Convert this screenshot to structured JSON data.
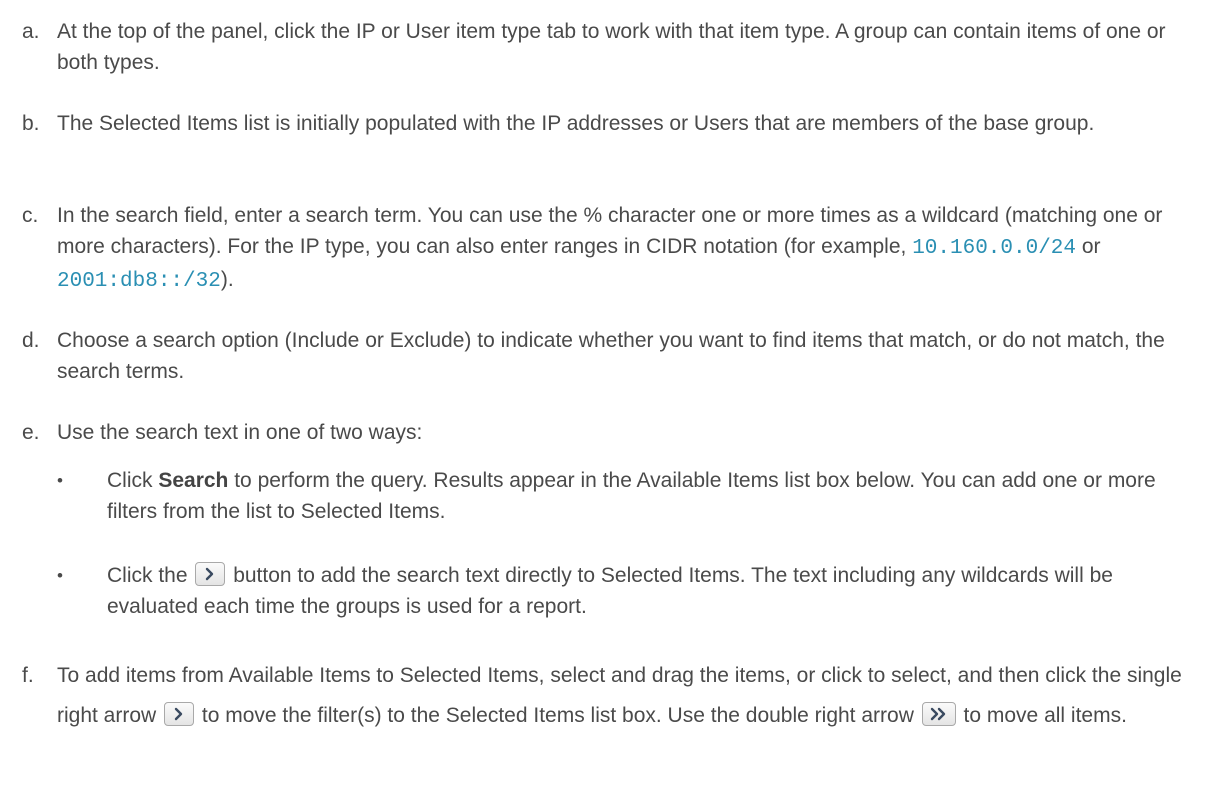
{
  "steps": [
    {
      "marker": "a.",
      "text": "At the top of the panel, click the IP or User item type tab to work with that item type. A group can contain items of one or both types."
    },
    {
      "marker": "b.",
      "text": "The Selected Items list is initially populated with the IP addresses or Users that are members of the base group."
    },
    {
      "marker": "c.",
      "text_1": "In the search field, enter a search term. You can use the % character one or more times as a wildcard (matching one or more characters). For the IP type, you can also enter ranges in CIDR notation (for example, ",
      "code_1": "10.160.0.0/24",
      "text_2": " or ",
      "code_2": "2001:db8::/32",
      "text_3": ")."
    },
    {
      "marker": "d.",
      "text": "Choose a search option (Include or Exclude) to indicate whether you want to find items that match, or do not match, the search terms."
    },
    {
      "marker": "e.",
      "text": "Use the search text in one of two ways:"
    },
    {
      "marker": "f.",
      "text_1": "To add items from Available Items to Selected Items, select and drag the items, or click to select, and then click the single right arrow ",
      "text_2": " to move the filter(s) to the Selected Items list box. Use the double right arrow ",
      "text_3": " to move all items."
    }
  ],
  "bullets": [
    {
      "marker": "•",
      "bold": "Search",
      "text_1": "Click ",
      "text_2": " to perform the query. Results appear in the Available Items list box below. You can add one or more filters from the list to Selected Items."
    },
    {
      "marker": "•",
      "text_1": "Click the ",
      "text_2": " button to add the search text directly to Selected Items. The text including any wildcards will be evaluated each time the groups is used for a report."
    }
  ],
  "icons": {
    "single_arrow": "chevron-right-icon",
    "double_arrow": "double-chevron-right-icon",
    "code_color": "#2a8fb3",
    "text_color": "#4a4a4a"
  }
}
